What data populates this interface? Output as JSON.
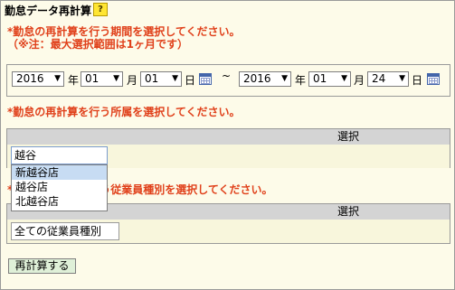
{
  "page": {
    "title": "勤怠データ再計算",
    "help_label": "?"
  },
  "instructions": {
    "period": "*勤怠の再計算を行う期間を選択してください。",
    "note": "（※注：最大選択範囲は1ヶ月です）",
    "affiliation": "*勤怠の再計算を行う所属を選択してください。",
    "employee_type": "*勤怠の再計算を行う従業員種別を選択してください。"
  },
  "date_range": {
    "start": {
      "year": "2016",
      "month": "01",
      "day": "01"
    },
    "separator": "~",
    "end": {
      "year": "2016",
      "month": "01",
      "day": "24"
    },
    "units": {
      "year": "年",
      "month": "月",
      "day": "日"
    }
  },
  "affiliation": {
    "header": "選択",
    "input_value": "越谷",
    "suggestions": [
      {
        "label": "新越谷店",
        "highlighted": true
      },
      {
        "label": "越谷店",
        "highlighted": false
      },
      {
        "label": "北越谷店",
        "highlighted": false
      }
    ]
  },
  "employee_type": {
    "header": "選択",
    "input_value": "全ての従業員種別"
  },
  "actions": {
    "recalc_label": "再計算する"
  },
  "icons": {
    "calendar": "calendar-icon",
    "dropdown": "chevron-down-icon"
  }
}
